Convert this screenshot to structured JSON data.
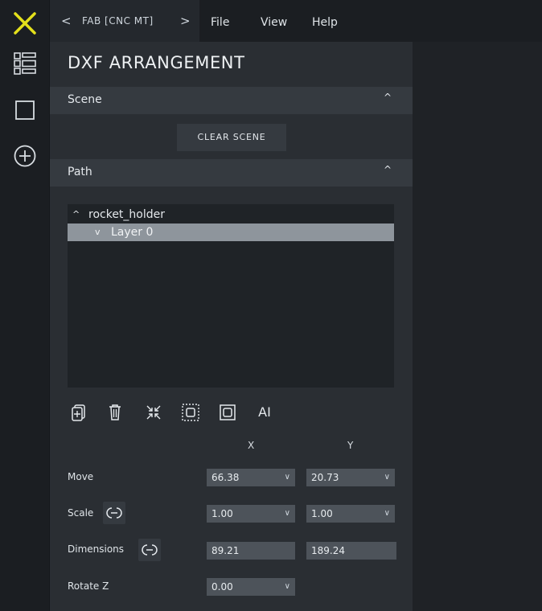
{
  "topbar": {
    "project_name": "FAB [CNC MT]",
    "prev_arrow": "<",
    "next_arrow": ">",
    "menus": [
      "File",
      "View",
      "Help"
    ]
  },
  "rail": {
    "icons": [
      "list-view-icon",
      "square-icon",
      "add-circle-icon"
    ]
  },
  "panel": {
    "title": "DXF ARRANGEMENT",
    "scene": {
      "heading": "Scene",
      "collapse_glyph": "^",
      "clear_label": "CLEAR SCENE"
    },
    "path": {
      "heading": "Path",
      "collapse_glyph": "^",
      "tree": [
        {
          "label": "rocket_holder",
          "glyph": "^",
          "selected": false
        },
        {
          "label": "Layer 0",
          "glyph": "v",
          "selected": true
        }
      ]
    },
    "toolbar_icons": [
      "add-layer-icon",
      "delete-icon",
      "shrink-icon",
      "frame-select-icon",
      "copy-icon",
      "text-icon"
    ],
    "text_tool_label": "AI",
    "axes": {
      "x": "X",
      "y": "Y"
    },
    "move": {
      "label": "Move",
      "x": "66.38",
      "y": "20.73"
    },
    "scale": {
      "label": "Scale",
      "x": "1.00",
      "y": "1.00"
    },
    "dimensions": {
      "label": "Dimensions",
      "x": "89.21",
      "y": "189.24"
    },
    "rotate": {
      "label": "Rotate Z",
      "z": "0.00"
    }
  },
  "colors": {
    "accent": "#e4e01b",
    "panel": "#2a2e33",
    "section": "#353a40",
    "field": "#4d535a",
    "selected_row": "#8e959c"
  }
}
